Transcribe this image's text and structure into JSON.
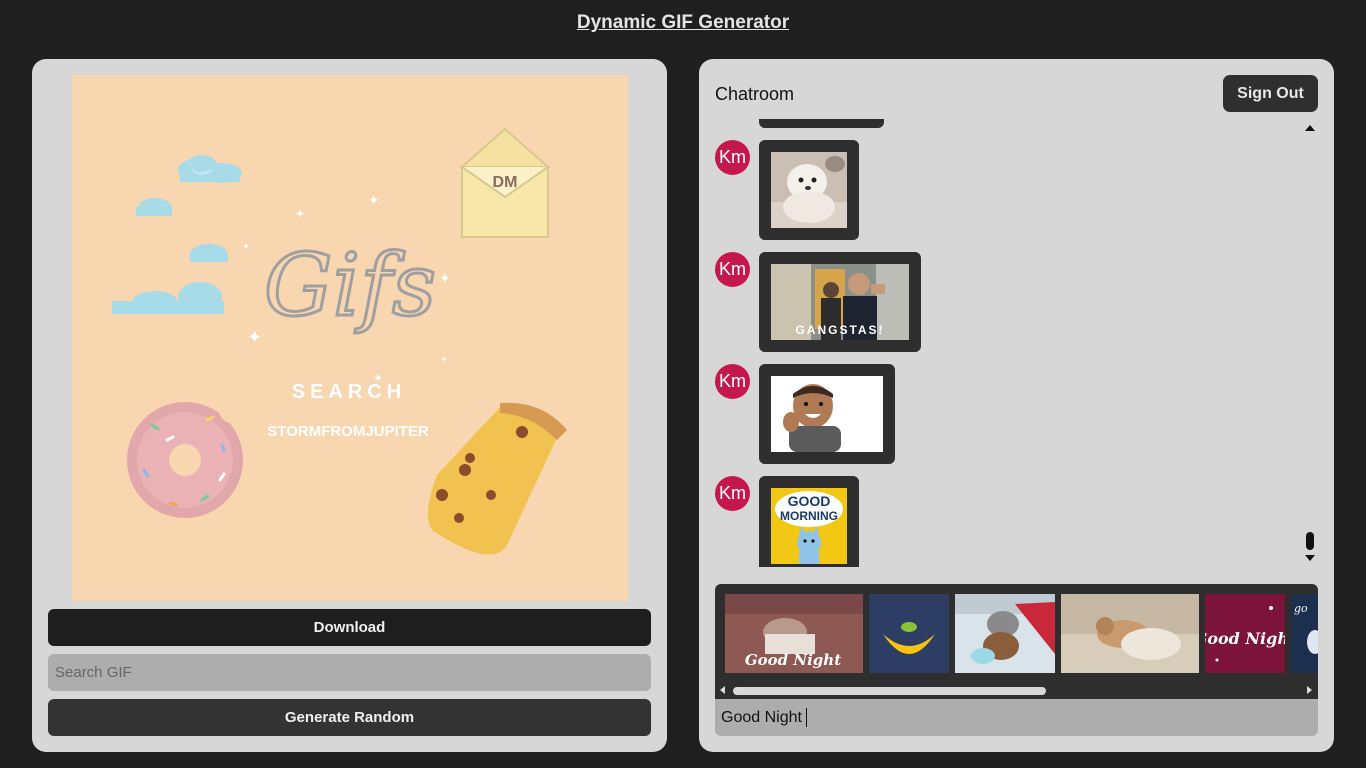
{
  "app": {
    "title": "Dynamic GIF Generator"
  },
  "preview": {
    "gif_text_script": "Gifs",
    "gif_text_dm": "DM",
    "gif_text_search": "SEARCH",
    "gif_text_handle": "STORMFROMJUPITER"
  },
  "controls": {
    "download_label": "Download",
    "search_placeholder": "Search GIF",
    "random_label": "Generate Random"
  },
  "chat": {
    "title": "Chatroom",
    "signout_label": "Sign Out",
    "messages": [
      {
        "avatar": "Km",
        "gif": "fluffy white puppy"
      },
      {
        "avatar": "Km",
        "gif": "GANGSTAS!",
        "caption": "GANGSTAS!"
      },
      {
        "avatar": "Km",
        "gif": "excited child"
      },
      {
        "avatar": "Km",
        "gif": "good morning cat",
        "caption_line1": "GOOD",
        "caption_line2": "MORNING"
      }
    ],
    "gif_results": [
      {
        "caption": "Good Night"
      },
      {
        "caption": ""
      },
      {
        "caption": ""
      },
      {
        "caption": ""
      },
      {
        "caption": "Good Night"
      },
      {
        "caption": "go"
      }
    ],
    "input_value": "Good Night"
  },
  "colors": {
    "background": "#1f1f1f",
    "panel": "#d7d7d7",
    "avatar": "#c4184d",
    "dark_button": "#1e1e1e"
  }
}
